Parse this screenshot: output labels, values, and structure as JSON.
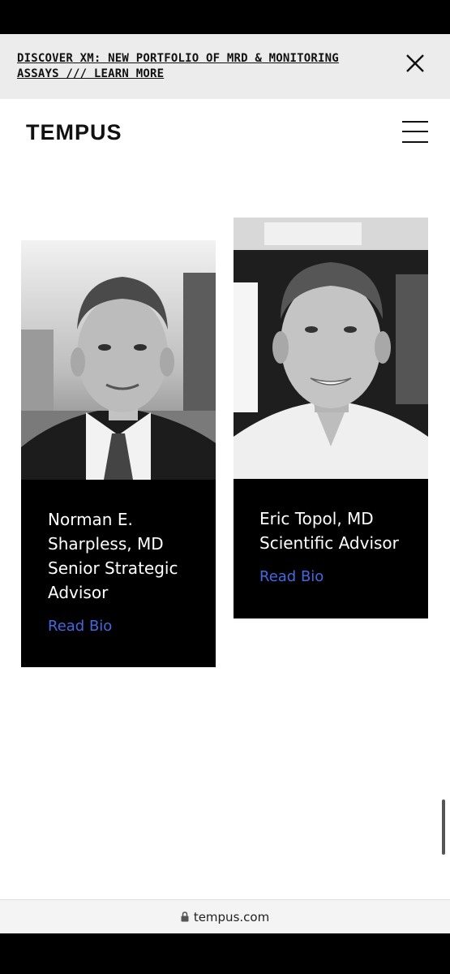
{
  "banner": {
    "text": "DISCOVER xM: NEW PORTFOLIO OF MRD & MONITORING ASSAYS /// LEARN MORE",
    "close_icon": "close-icon"
  },
  "header": {
    "logo": "TEMPUS",
    "menu_icon": "hamburger-menu-icon"
  },
  "advisors": [
    {
      "name": "Norman E. Sharpless, MD",
      "role": "Senior Strategic Advisor",
      "link": "Read Bio"
    },
    {
      "name": "Eric Topol, MD",
      "role": "Scientific Advisor",
      "link": "Read Bio"
    }
  ],
  "browser": {
    "url": "tempus.com",
    "lock_icon": "lock-icon"
  },
  "colors": {
    "accent_link": "#4169e1",
    "card_bg": "#000000",
    "banner_bg": "#ececec"
  }
}
